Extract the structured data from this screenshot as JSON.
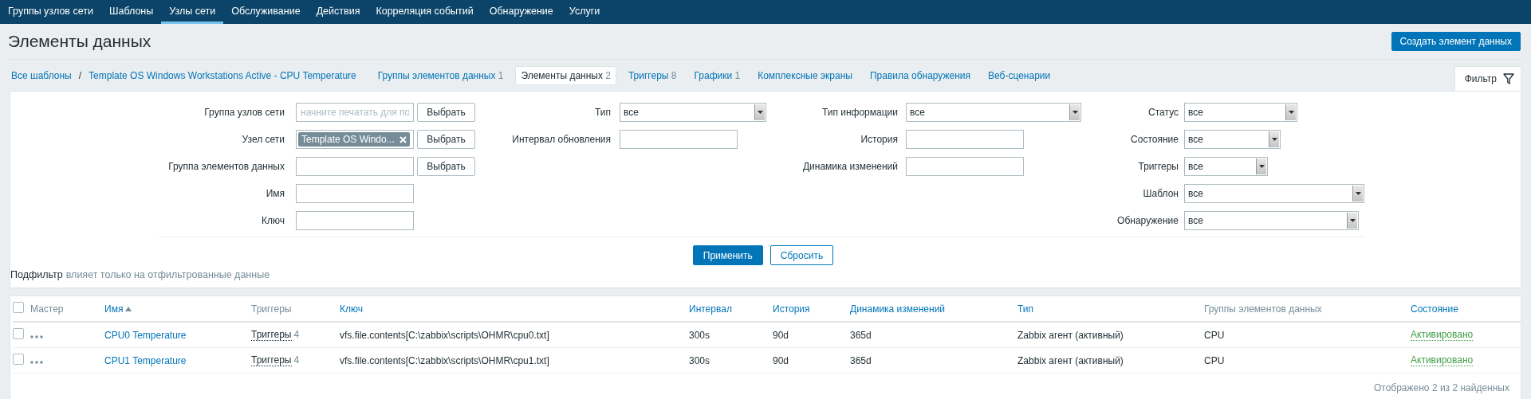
{
  "top_nav": {
    "items": [
      {
        "label": "Группы узлов сети",
        "selected": false
      },
      {
        "label": "Шаблоны",
        "selected": false
      },
      {
        "label": "Узлы сети",
        "selected": true
      },
      {
        "label": "Обслуживание",
        "selected": false
      },
      {
        "label": "Действия",
        "selected": false
      },
      {
        "label": "Корреляция событий",
        "selected": false
      },
      {
        "label": "Обнаружение",
        "selected": false
      },
      {
        "label": "Услуги",
        "selected": false
      }
    ]
  },
  "page": {
    "title": "Элементы данных",
    "create_button": "Создать элемент данных"
  },
  "breadcrumbs": {
    "items": [
      "Все шаблоны",
      "Template OS Windows Workstations Active - CPU Temperature"
    ],
    "separator": "/"
  },
  "tabs": [
    {
      "label": "Группы элементов данных",
      "count": "1",
      "selected": false
    },
    {
      "label": "Элементы данных",
      "count": "2",
      "selected": true
    },
    {
      "label": "Триггеры",
      "count": "8",
      "selected": false
    },
    {
      "label": "Графики",
      "count": "1",
      "selected": false
    },
    {
      "label": "Комплексные экраны",
      "selected": false
    },
    {
      "label": "Правила обнаружения",
      "selected": false
    },
    {
      "label": "Веб-сценарии",
      "selected": false
    }
  ],
  "filter_tab": {
    "label": "Фильтр"
  },
  "filter": {
    "columns": [
      [
        {
          "label": "Группа узлов сети",
          "kind": "multiselect",
          "placeholder": "начните печатать для по",
          "button": "Выбрать"
        },
        {
          "label": "Узел сети",
          "kind": "multiselect",
          "chips": [
            "Template OS Windo..."
          ],
          "button": "Выбрать"
        },
        {
          "label": "Группа элементов данных",
          "kind": "multiselect",
          "button": "Выбрать"
        },
        {
          "label": "Имя",
          "kind": "input"
        },
        {
          "label": "Ключ",
          "kind": "input"
        }
      ],
      [
        {
          "label": "Тип",
          "kind": "select",
          "value": "все"
        },
        {
          "label": "Интервал обновления",
          "kind": "input"
        }
      ],
      [
        {
          "label": "Тип информации",
          "kind": "select",
          "value": "все"
        },
        {
          "label": "История",
          "kind": "input"
        },
        {
          "label": "Динамика изменений",
          "kind": "input"
        }
      ],
      [
        {
          "label": "Статус",
          "kind": "select",
          "value": "все"
        },
        {
          "label": "Состояние",
          "kind": "select",
          "value": "все"
        },
        {
          "label": "Триггеры",
          "kind": "select",
          "value": "все"
        },
        {
          "label": "Шаблон",
          "kind": "select",
          "value": "все"
        },
        {
          "label": "Обнаружение",
          "kind": "select",
          "value": "все"
        }
      ]
    ],
    "apply_button": "Применить",
    "reset_button": "Сбросить"
  },
  "subfilter": {
    "title": "Подфильтр",
    "note": "влияет только на отфильтрованные данные"
  },
  "table": {
    "select_all_checked": false,
    "columns": [
      {
        "label": "Мастер",
        "sortable": false,
        "sorted": false
      },
      {
        "label": "Имя",
        "sortable": true,
        "sorted": true
      },
      {
        "label": "Триггеры",
        "sortable": false,
        "sorted": false
      },
      {
        "label": "Ключ",
        "sortable": true,
        "sorted": false
      },
      {
        "label": "Интервал",
        "sortable": true,
        "sorted": false
      },
      {
        "label": "История",
        "sortable": true,
        "sorted": false
      },
      {
        "label": "Динамика изменений",
        "sortable": true,
        "sorted": false
      },
      {
        "label": "Тип",
        "sortable": true,
        "sorted": false
      },
      {
        "label": "Группы элементов данных",
        "sortable": false,
        "sorted": false
      },
      {
        "label": "Состояние",
        "sortable": true,
        "sorted": false
      }
    ],
    "rows": [
      {
        "checked": false,
        "name": "CPU0 Temperature",
        "triggers": "Триггеры",
        "trigger_count": "4",
        "key": "vfs.file.contents[C:\\zabbix\\scripts\\OHMR\\cpu0.txt]",
        "interval": "300s",
        "history": "90d",
        "trends": "365d",
        "type": "Zabbix агент (активный)",
        "group": "CPU",
        "status": "Активировано",
        "enabled": true
      },
      {
        "checked": false,
        "name": "CPU1 Temperature",
        "triggers": "Триггеры",
        "trigger_count": "4",
        "key": "vfs.file.contents[C:\\zabbix\\scripts\\OHMR\\cpu1.txt]",
        "interval": "300s",
        "history": "90d",
        "trends": "365d",
        "type": "Zabbix агент (активный)",
        "group": "CPU",
        "status": "Активировано",
        "enabled": true
      }
    ],
    "footer": "Отображено 2 из 2 найденных"
  }
}
